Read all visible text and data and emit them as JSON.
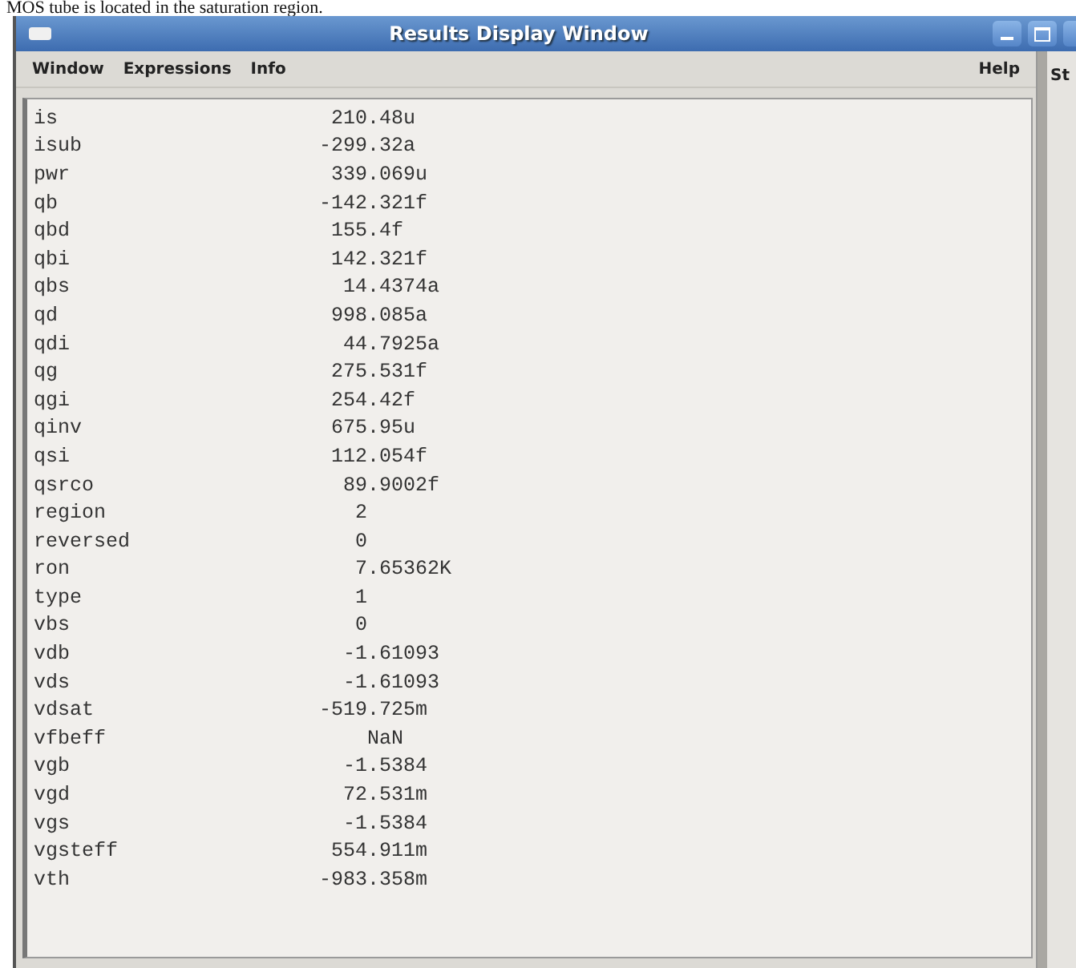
{
  "document_caption": "MOS tube is located in the saturation region.",
  "window": {
    "title": "Results Display Window"
  },
  "menu": [
    "Window",
    "Expressions",
    "Info"
  ],
  "menu_right": "Help",
  "side_panel_label": "St",
  "results": [
    {
      "name": "is",
      "value": "210.48u"
    },
    {
      "name": "isub",
      "value": "-299.32a"
    },
    {
      "name": "pwr",
      "value": "339.069u"
    },
    {
      "name": "qb",
      "value": "-142.321f"
    },
    {
      "name": "qbd",
      "value": "155.4f"
    },
    {
      "name": "qbi",
      "value": "142.321f"
    },
    {
      "name": "qbs",
      "value": "14.4374a"
    },
    {
      "name": "qd",
      "value": "998.085a"
    },
    {
      "name": "qdi",
      "value": "44.7925a"
    },
    {
      "name": "qg",
      "value": "275.531f"
    },
    {
      "name": "qgi",
      "value": "254.42f"
    },
    {
      "name": "qinv",
      "value": "675.95u"
    },
    {
      "name": "qsi",
      "value": "112.054f"
    },
    {
      "name": "qsrco",
      "value": "89.9002f"
    },
    {
      "name": "region",
      "value": "2"
    },
    {
      "name": "reversed",
      "value": "0"
    },
    {
      "name": "ron",
      "value": "7.65362K"
    },
    {
      "name": "type",
      "value": "1"
    },
    {
      "name": "vbs",
      "value": "0"
    },
    {
      "name": "vdb",
      "value": "-1.61093"
    },
    {
      "name": "vds",
      "value": "-1.61093"
    },
    {
      "name": "vdsat",
      "value": "-519.725m"
    },
    {
      "name": "vfbeff",
      "value": "NaN"
    },
    {
      "name": "vgb",
      "value": "-1.5384"
    },
    {
      "name": "vgd",
      "value": "72.531m"
    },
    {
      "name": "vgs",
      "value": "-1.5384"
    },
    {
      "name": "vgsteff",
      "value": "554.911m"
    },
    {
      "name": "vth",
      "value": "-983.358m"
    }
  ]
}
